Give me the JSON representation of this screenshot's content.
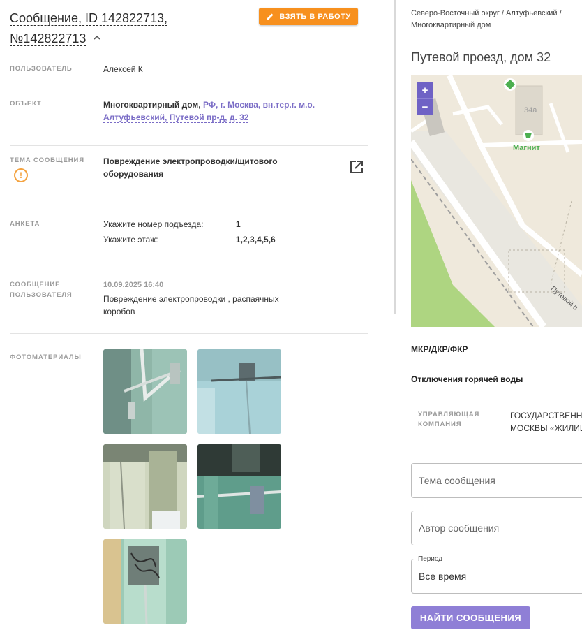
{
  "header": {
    "title_line1": "Сообщение, ID 142822713,",
    "title_line2": "№142822713",
    "take_button": "ВЗЯТЬ В РАБОТУ"
  },
  "fields": {
    "user_label": "ПОЛЬЗОВАТЕЛЬ",
    "user_value": "Алексей К",
    "object_label": "ОБЪЕКТ",
    "object_type": "Многоквартирный дом,",
    "object_link_line1": "РФ, г. Москва, вн.тер.г. м.о.",
    "object_link_line2": "Алтуфьевский, Путевой пр-д, д. 32",
    "topic_label": "ТЕМА СООБЩЕНИЯ",
    "topic_line1": "Повреждение электропроводки/щитового",
    "topic_line2": "оборудования",
    "form_label": "АНКЕТА",
    "q1_label": "Укажите номер подъезда:",
    "q1_value": "1",
    "q2_label": "Укажите этаж:",
    "q2_value": "1,2,3,4,5,6",
    "msg_label_line1": "СООБЩЕНИЕ",
    "msg_label_line2": "ПОЛЬЗОВАТЕЛЯ",
    "msg_date": "10.09.2025 16:40",
    "msg_line1": "Повреждение электропроводки , распаячных",
    "msg_line2": "коробов",
    "photos_label": "ФОТОМАТЕРИАЛЫ"
  },
  "right": {
    "breadcrumb_line1": "Северо-Восточный округ / Алтуфьевский /",
    "breadcrumb_line2": "Многоквартирный дом",
    "address": "Путевой проезд, дом 32",
    "map": {
      "zoom_in": "+",
      "zoom_out": "−",
      "building_label": "34a",
      "store_label": "Магнит",
      "street_label": "Путевой п"
    },
    "mkr": "МКР/ДКР/ФКР",
    "hot_water": "Отключения горячей воды",
    "mc_label_line1": "УПРАВЛЯЮЩАЯ",
    "mc_label_line2": "КОМПАНИЯ",
    "mc_value_line1": "ГОСУДАРСТВЕННО",
    "mc_value_line2": "МОСКВЫ «ЖИЛИЦ",
    "topic_placeholder": "Тема сообщения",
    "author_placeholder": "Автор сообщения",
    "period_legend": "Период",
    "period_value": "Все время",
    "find_button": "НАЙТИ СООБЩЕНИЯ"
  },
  "colors": {
    "accent_orange": "#f7901e",
    "accent_purple": "#8f7fd6",
    "link_purple": "#7a6cc6",
    "warning": "#f4a340"
  }
}
